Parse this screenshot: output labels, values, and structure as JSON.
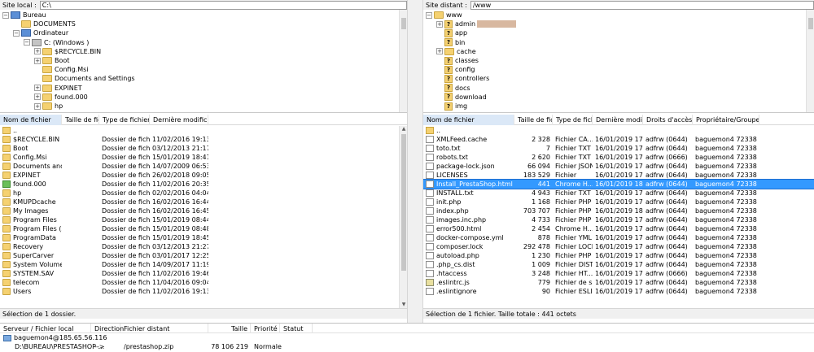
{
  "local": {
    "site_label": "Site local :",
    "path": "C:\\",
    "tree": [
      {
        "label": "Bureau",
        "icon": "monitor",
        "expander": "−",
        "indent": 0
      },
      {
        "label": "DOCUMENTS",
        "icon": "folder",
        "expander": "",
        "indent": 1
      },
      {
        "label": "Ordinateur",
        "icon": "monitor",
        "expander": "−",
        "indent": 1
      },
      {
        "label": "C: (Windows )",
        "icon": "drive",
        "expander": "−",
        "indent": 2
      },
      {
        "label": "$RECYCLE.BIN",
        "icon": "folder",
        "expander": "+",
        "indent": 3
      },
      {
        "label": "Boot",
        "icon": "folder",
        "expander": "+",
        "indent": 3
      },
      {
        "label": "Config.Msi",
        "icon": "folder",
        "expander": "",
        "indent": 3
      },
      {
        "label": "Documents and Settings",
        "icon": "folder",
        "expander": "",
        "indent": 3
      },
      {
        "label": "EXPINET",
        "icon": "folder",
        "expander": "+",
        "indent": 3
      },
      {
        "label": "found.000",
        "icon": "folder",
        "expander": "+",
        "indent": 3
      },
      {
        "label": "hp",
        "icon": "folder",
        "expander": "+",
        "indent": 3
      }
    ],
    "columns": [
      "Nom de fichier",
      "Taille de fichier",
      "Type de fichier",
      "Dernière modificat..."
    ],
    "files": [
      {
        "name": "..",
        "size": "",
        "type": "",
        "modified": "",
        "icon": "up"
      },
      {
        "name": "$RECYCLE.BIN",
        "size": "",
        "type": "Dossier de fichi...",
        "modified": "11/02/2016 19:13:55",
        "icon": "folder"
      },
      {
        "name": "Boot",
        "size": "",
        "type": "Dossier de fichi...",
        "modified": "03/12/2013 21:17:26",
        "icon": "folder"
      },
      {
        "name": "Config.Msi",
        "size": "",
        "type": "Dossier de fichi...",
        "modified": "15/01/2019 18:41:25",
        "icon": "folder"
      },
      {
        "name": "Documents and ...",
        "size": "",
        "type": "Dossier de fichi...",
        "modified": "14/07/2009 06:53:55",
        "icon": "folder"
      },
      {
        "name": "EXPINET",
        "size": "",
        "type": "Dossier de fichi...",
        "modified": "26/02/2018 09:05:35",
        "icon": "folder"
      },
      {
        "name": "found.000",
        "size": "",
        "type": "Dossier de fichi...",
        "modified": "11/02/2016 20:35:46",
        "icon": "sys"
      },
      {
        "name": "hp",
        "size": "",
        "type": "Dossier de fichi...",
        "modified": "02/02/2016 04:04:38",
        "icon": "folder"
      },
      {
        "name": "KMUPDcache",
        "size": "",
        "type": "Dossier de fichi...",
        "modified": "16/02/2016 16:44:29",
        "icon": "folder"
      },
      {
        "name": "My Images",
        "size": "",
        "type": "Dossier de fichi...",
        "modified": "16/02/2016 16:45:30",
        "icon": "folder"
      },
      {
        "name": "Program Files",
        "size": "",
        "type": "Dossier de fichi...",
        "modified": "15/01/2019 08:44:45",
        "icon": "folder"
      },
      {
        "name": "Program Files (x...",
        "size": "",
        "type": "Dossier de fichi...",
        "modified": "15/01/2019 08:48:40",
        "icon": "folder"
      },
      {
        "name": "ProgramData",
        "size": "",
        "type": "Dossier de fichi...",
        "modified": "15/01/2019 18:45:03",
        "icon": "folder"
      },
      {
        "name": "Recovery",
        "size": "",
        "type": "Dossier de fichi...",
        "modified": "03/12/2013 21:27:34",
        "icon": "folder"
      },
      {
        "name": "SuperCarver",
        "size": "",
        "type": "Dossier de fichi...",
        "modified": "03/01/2017 12:25:57",
        "icon": "folder"
      },
      {
        "name": "System Volume ...",
        "size": "",
        "type": "Dossier de fichi...",
        "modified": "14/09/2017 11:19:50",
        "icon": "folder"
      },
      {
        "name": "SYSTEM.SAV",
        "size": "",
        "type": "Dossier de fichi...",
        "modified": "11/02/2016 19:46:24",
        "icon": "folder"
      },
      {
        "name": "telecom",
        "size": "",
        "type": "Dossier de fichi...",
        "modified": "11/04/2016 09:04:15",
        "icon": "folder"
      },
      {
        "name": "Users",
        "size": "",
        "type": "Dossier de fichi...",
        "modified": "11/02/2016 19:13:16",
        "icon": "folder"
      }
    ],
    "status": "Sélection de 1 dossier."
  },
  "remote": {
    "site_label": "Site distant :",
    "path": "/www",
    "tree": [
      {
        "label": "www",
        "icon": "folder",
        "expander": "−",
        "indent": 0
      },
      {
        "label": "admin",
        "icon": "qmark",
        "expander": "+",
        "indent": 1,
        "redacted": true
      },
      {
        "label": "app",
        "icon": "qmark",
        "expander": "",
        "indent": 1
      },
      {
        "label": "bin",
        "icon": "qmark",
        "expander": "",
        "indent": 1
      },
      {
        "label": "cache",
        "icon": "folder",
        "expander": "+",
        "indent": 1
      },
      {
        "label": "classes",
        "icon": "qmark",
        "expander": "",
        "indent": 1
      },
      {
        "label": "config",
        "icon": "qmark",
        "expander": "",
        "indent": 1
      },
      {
        "label": "controllers",
        "icon": "qmark",
        "expander": "",
        "indent": 1
      },
      {
        "label": "docs",
        "icon": "qmark",
        "expander": "",
        "indent": 1
      },
      {
        "label": "download",
        "icon": "qmark",
        "expander": "",
        "indent": 1
      },
      {
        "label": "img",
        "icon": "qmark",
        "expander": "",
        "indent": 1
      }
    ],
    "columns": [
      "Nom de fichier",
      "Taille de fic...",
      "Type de fichi...",
      "Dernière modifi...",
      "Droits d'accès",
      "Propriétaire/Groupe"
    ],
    "files": [
      {
        "name": "..",
        "size": "",
        "type": "",
        "modified": "",
        "perms": "",
        "owner": "",
        "icon": "up"
      },
      {
        "name": "XMLFeed.cache",
        "size": "2 328",
        "type": "Fichier CA...",
        "modified": "16/01/2019 17:...",
        "perms": "adfrw (0644)",
        "owner": "baguemon4 72338",
        "icon": "file"
      },
      {
        "name": "toto.txt",
        "size": "7",
        "type": "Fichier TXT",
        "modified": "16/01/2019 17:...",
        "perms": "adfrw (0644)",
        "owner": "baguemon4 72338",
        "icon": "file"
      },
      {
        "name": "robots.txt",
        "size": "2 620",
        "type": "Fichier TXT",
        "modified": "16/01/2019 17:...",
        "perms": "adfrw (0666)",
        "owner": "baguemon4 72338",
        "icon": "file"
      },
      {
        "name": "package-lock.json",
        "size": "66 094",
        "type": "Fichier JSON",
        "modified": "16/01/2019 17:...",
        "perms": "adfrw (0644)",
        "owner": "baguemon4 72338",
        "icon": "file"
      },
      {
        "name": "LICENSES",
        "size": "183 529",
        "type": "Fichier",
        "modified": "16/01/2019 17:...",
        "perms": "adfrw (0644)",
        "owner": "baguemon4 72338",
        "icon": "file"
      },
      {
        "name": "Install_PrestaShop.html",
        "size": "441",
        "type": "Chrome H...",
        "modified": "16/01/2019 18:...",
        "perms": "adfrw (0644)",
        "owner": "baguemon4 72338",
        "icon": "file",
        "selected": true
      },
      {
        "name": "INSTALL.txt",
        "size": "4 943",
        "type": "Fichier TXT",
        "modified": "16/01/2019 17:...",
        "perms": "adfrw (0644)",
        "owner": "baguemon4 72338",
        "icon": "file"
      },
      {
        "name": "init.php",
        "size": "1 168",
        "type": "Fichier PHP",
        "modified": "16/01/2019 17:...",
        "perms": "adfrw (0644)",
        "owner": "baguemon4 72338",
        "icon": "file"
      },
      {
        "name": "index.php",
        "size": "703 707",
        "type": "Fichier PHP",
        "modified": "16/01/2019 18:...",
        "perms": "adfrw (0644)",
        "owner": "baguemon4 72338",
        "icon": "file"
      },
      {
        "name": "images.inc.php",
        "size": "4 733",
        "type": "Fichier PHP",
        "modified": "16/01/2019 17:...",
        "perms": "adfrw (0644)",
        "owner": "baguemon4 72338",
        "icon": "file"
      },
      {
        "name": "error500.html",
        "size": "2 454",
        "type": "Chrome H...",
        "modified": "16/01/2019 17:...",
        "perms": "adfrw (0644)",
        "owner": "baguemon4 72338",
        "icon": "file"
      },
      {
        "name": "docker-compose.yml",
        "size": "878",
        "type": "Fichier YML",
        "modified": "16/01/2019 17:...",
        "perms": "adfrw (0644)",
        "owner": "baguemon4 72338",
        "icon": "file"
      },
      {
        "name": "composer.lock",
        "size": "292 478",
        "type": "Fichier LOCK",
        "modified": "16/01/2019 17:...",
        "perms": "adfrw (0644)",
        "owner": "baguemon4 72338",
        "icon": "file"
      },
      {
        "name": "autoload.php",
        "size": "1 230",
        "type": "Fichier PHP",
        "modified": "16/01/2019 17:...",
        "perms": "adfrw (0644)",
        "owner": "baguemon4 72338",
        "icon": "file"
      },
      {
        "name": ".php_cs.dist",
        "size": "1 009",
        "type": "Fichier DIST",
        "modified": "16/01/2019 17:...",
        "perms": "adfrw (0644)",
        "owner": "baguemon4 72338",
        "icon": "file"
      },
      {
        "name": ".htaccess",
        "size": "3 248",
        "type": "Fichier HT...",
        "modified": "16/01/2019 17:...",
        "perms": "adfrw (0666)",
        "owner": "baguemon4 72338",
        "icon": "file"
      },
      {
        "name": ".eslintrc.js",
        "size": "779",
        "type": "Fichier de s...",
        "modified": "16/01/2019 17:...",
        "perms": "adfrw (0644)",
        "owner": "baguemon4 72338",
        "icon": "js"
      },
      {
        "name": ".eslintignore",
        "size": "90",
        "type": "Fichier ESLI...",
        "modified": "16/01/2019 17:...",
        "perms": "adfrw (0644)",
        "owner": "baguemon4 72338",
        "icon": "file"
      }
    ],
    "status": "Sélection de 1 fichier. Taille totale : 441 octets"
  },
  "queue": {
    "columns": [
      "Serveur / Fichier local",
      "Direction",
      "Fichier distant",
      "Taille",
      "Priorité",
      "Statut"
    ],
    "server": "baguemon4@185.65.56.116",
    "row": {
      "local": "D:\\BUREAU\\PRESTASHOP ...",
      "direction": "-->",
      "remote": "/prestashop.zip",
      "size": "78 106 219",
      "priority": "Normale",
      "status": ""
    }
  }
}
